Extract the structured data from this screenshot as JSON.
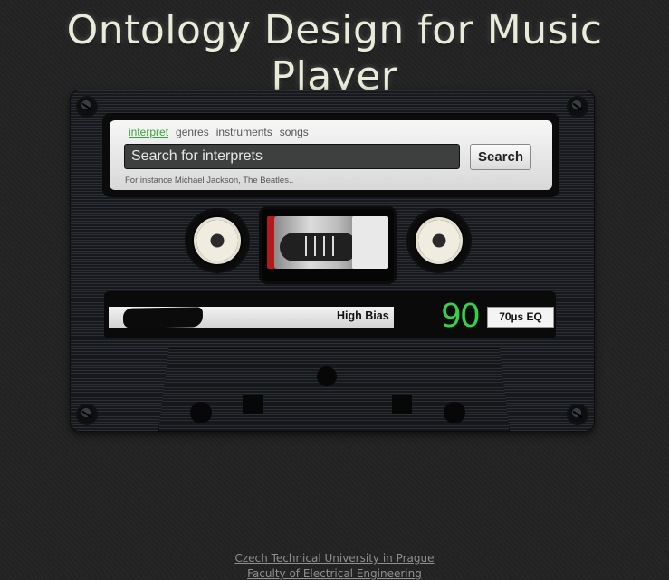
{
  "page": {
    "title": "Ontology Design for Music Player"
  },
  "search": {
    "tabs": [
      {
        "label": "interpret",
        "active": true
      },
      {
        "label": "genres",
        "active": false
      },
      {
        "label": "instruments",
        "active": false
      },
      {
        "label": "songs",
        "active": false
      }
    ],
    "placeholder": "Search for interprets",
    "button_label": "Search",
    "hint": "For instance Michael Jackson, The Beatles.."
  },
  "cassette": {
    "bias_label": "High Bias",
    "length_label": "90",
    "eq_label": "70µs EQ"
  },
  "footer": {
    "university": "Czech Technical University in Prague",
    "faculty": "Faculty of Electrical Engineering"
  },
  "colors": {
    "accent_green": "#3aa13a",
    "number_green": "#38d048",
    "background": "#232323",
    "title": "#e8ecd8"
  }
}
